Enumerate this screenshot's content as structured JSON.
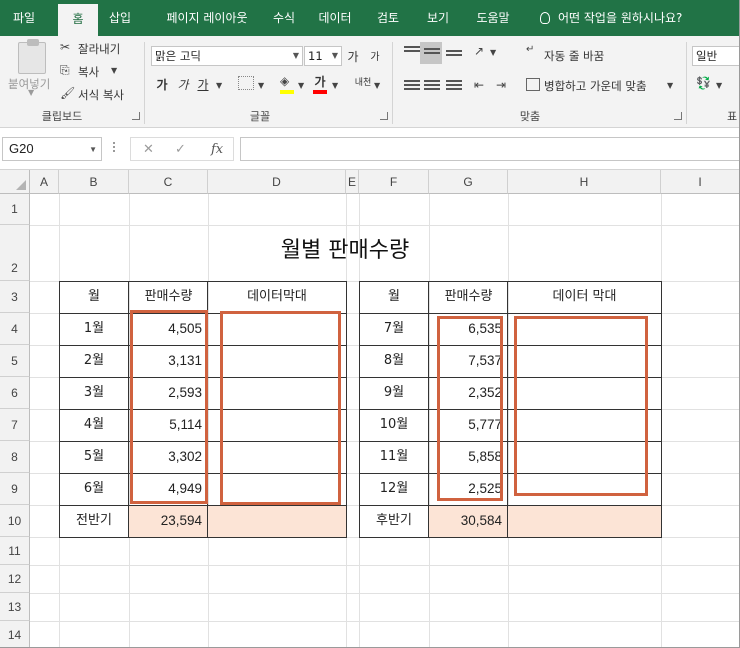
{
  "ribbon_tabs": [
    "파일",
    "홈",
    "삽입",
    "페이지 레이아웃",
    "수식",
    "데이터",
    "검토",
    "보기",
    "도움말"
  ],
  "active_tab": "홈",
  "tell_me": "어떤 작업을 원하시나요?",
  "clipboard": {
    "paste": "붙여넣기",
    "cut": "잘라내기",
    "copy": "복사",
    "format_painter": "서식 복사",
    "label": "클립보드"
  },
  "font": {
    "name": "맑은 고딕",
    "size": "11",
    "grow": "가",
    "shrink": "가",
    "bold": "가",
    "italic": "가",
    "underline": "가",
    "color_glyph": "가",
    "phonetic": "내천",
    "label": "글꼴"
  },
  "alignment": {
    "wrap_text": "자동 줄 바꿈",
    "merge_center": "병합하고 가운데 맞춤",
    "label": "맞춤"
  },
  "number": {
    "format": "일반",
    "label": "표"
  },
  "formula_bar": {
    "name_box": "G20",
    "cancel": "✕",
    "enter": "✓",
    "fx": "fx",
    "value": ""
  },
  "columns": [
    "A",
    "B",
    "C",
    "D",
    "E",
    "F",
    "G",
    "H",
    "I"
  ],
  "rows": [
    "1",
    "2",
    "3",
    "4",
    "5",
    "6",
    "7",
    "8",
    "9",
    "10",
    "11",
    "12",
    "13",
    "14"
  ],
  "sheet": {
    "title": "월별 판매수량",
    "left_table": {
      "headers": [
        "월",
        "판매수량",
        "데이터막대"
      ],
      "rows": [
        {
          "month": "1월",
          "qty": "4,505"
        },
        {
          "month": "2월",
          "qty": "3,131"
        },
        {
          "month": "3월",
          "qty": "2,593"
        },
        {
          "month": "4월",
          "qty": "5,114"
        },
        {
          "month": "5월",
          "qty": "3,302"
        },
        {
          "month": "6월",
          "qty": "4,949"
        }
      ],
      "total_label": "전반기",
      "total": "23,594"
    },
    "right_table": {
      "headers": [
        "월",
        "판매수량",
        "데이터 막대"
      ],
      "rows": [
        {
          "month": "7월",
          "qty": "6,535"
        },
        {
          "month": "8월",
          "qty": "7,537"
        },
        {
          "month": "9월",
          "qty": "2,352"
        },
        {
          "month": "10월",
          "qty": "5,777"
        },
        {
          "month": "11월",
          "qty": "5,858"
        },
        {
          "month": "12월",
          "qty": "2,525"
        }
      ],
      "total_label": "후반기",
      "total": "30,584"
    }
  },
  "colors": {
    "ribbon_green": "#217346",
    "total_fill": "#fce4d6",
    "highlight_box": "#d0623f",
    "font_highlight": "#ffff00",
    "font_color": "#ff0000"
  }
}
